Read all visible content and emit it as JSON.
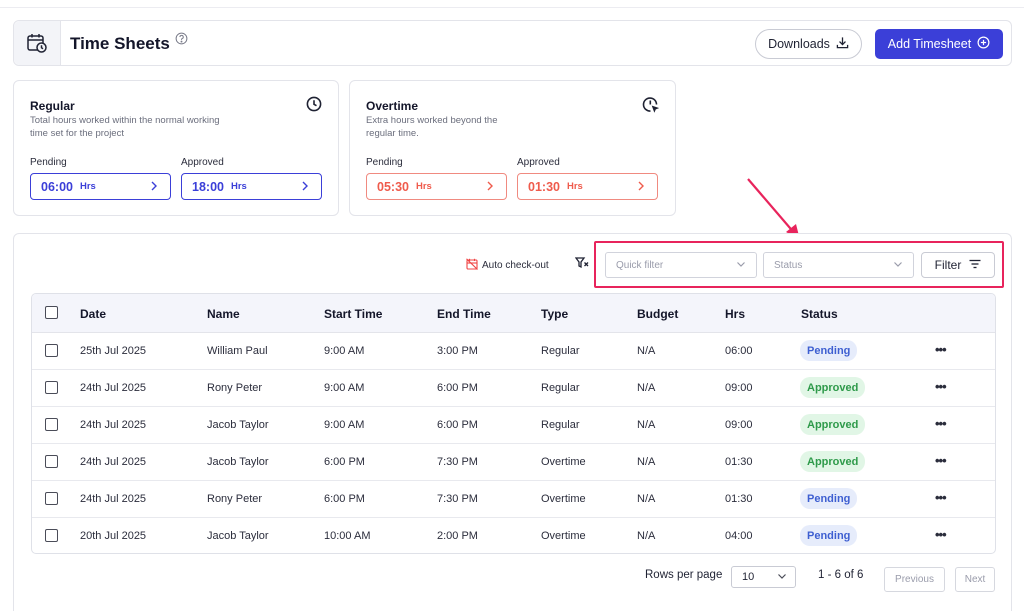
{
  "header": {
    "title": "Time Sheets",
    "downloads_label": "Downloads",
    "add_label": "Add Timesheet"
  },
  "regular": {
    "title": "Regular",
    "desc": "Total hours worked within the normal working time set for the project",
    "pending_label": "Pending",
    "pending_value": "06:00",
    "approved_label": "Approved",
    "approved_value": "18:00",
    "unit": "Hrs"
  },
  "overtime": {
    "title": "Overtime",
    "desc": "Extra hours worked beyond the regular time.",
    "pending_label": "Pending",
    "pending_value": "05:30",
    "approved_label": "Approved",
    "approved_value": "01:30",
    "unit": "Hrs"
  },
  "toolbar": {
    "auto_checkout": "Auto check-out",
    "quick_filter_placeholder": "Quick filter",
    "status_placeholder": "Status",
    "filter_label": "Filter"
  },
  "table": {
    "columns": [
      "Date",
      "Name",
      "Start Time",
      "End Time",
      "Type",
      "Budget",
      "Hrs",
      "Status"
    ],
    "rows": [
      {
        "date": "25th Jul 2025",
        "name": "William Paul",
        "start": "9:00 AM",
        "end": "3:00 PM",
        "type": "Regular",
        "budget": "N/A",
        "hrs": "06:00",
        "status": "Pending"
      },
      {
        "date": "24th Jul 2025",
        "name": "Rony Peter",
        "start": "9:00 AM",
        "end": "6:00 PM",
        "type": "Regular",
        "budget": "N/A",
        "hrs": "09:00",
        "status": "Approved"
      },
      {
        "date": "24th Jul 2025",
        "name": "Jacob Taylor",
        "start": "9:00 AM",
        "end": "6:00 PM",
        "type": "Regular",
        "budget": "N/A",
        "hrs": "09:00",
        "status": "Approved"
      },
      {
        "date": "24th Jul 2025",
        "name": "Jacob Taylor",
        "start": "6:00 PM",
        "end": "7:30 PM",
        "type": "Overtime",
        "budget": "N/A",
        "hrs": "01:30",
        "status": "Approved"
      },
      {
        "date": "24th Jul 2025",
        "name": "Rony Peter",
        "start": "6:00 PM",
        "end": "7:30 PM",
        "type": "Overtime",
        "budget": "N/A",
        "hrs": "01:30",
        "status": "Pending"
      },
      {
        "date": "20th Jul 2025",
        "name": "Jacob Taylor",
        "start": "10:00 AM",
        "end": "2:00 PM",
        "type": "Overtime",
        "budget": "N/A",
        "hrs": "04:00",
        "status": "Pending"
      }
    ],
    "more_label": "•••"
  },
  "pagination": {
    "rows_per_page_label": "Rows per page",
    "rows_per_page_value": "10",
    "range": "1 - 6 of 6",
    "previous_label": "Previous",
    "next_label": "Next"
  },
  "colors": {
    "primary": "#3b3fd8",
    "overtime": "#ef5b4c",
    "highlight": "#e8245c",
    "pending_badge": "#3e5fd1",
    "approved_badge": "#2e9a4a"
  },
  "icons": {
    "header": "calendar-clock-icon",
    "help": "help-circle-icon",
    "downloads": "download-icon",
    "add": "plus-circle-icon",
    "regular": "clock-icon",
    "overtime": "clock-cursor-icon",
    "auto_checkout": "calendar-off-icon",
    "filter_clear": "filter-x-icon",
    "filter": "filter-lines-icon",
    "annotation": "arrow-icon"
  }
}
